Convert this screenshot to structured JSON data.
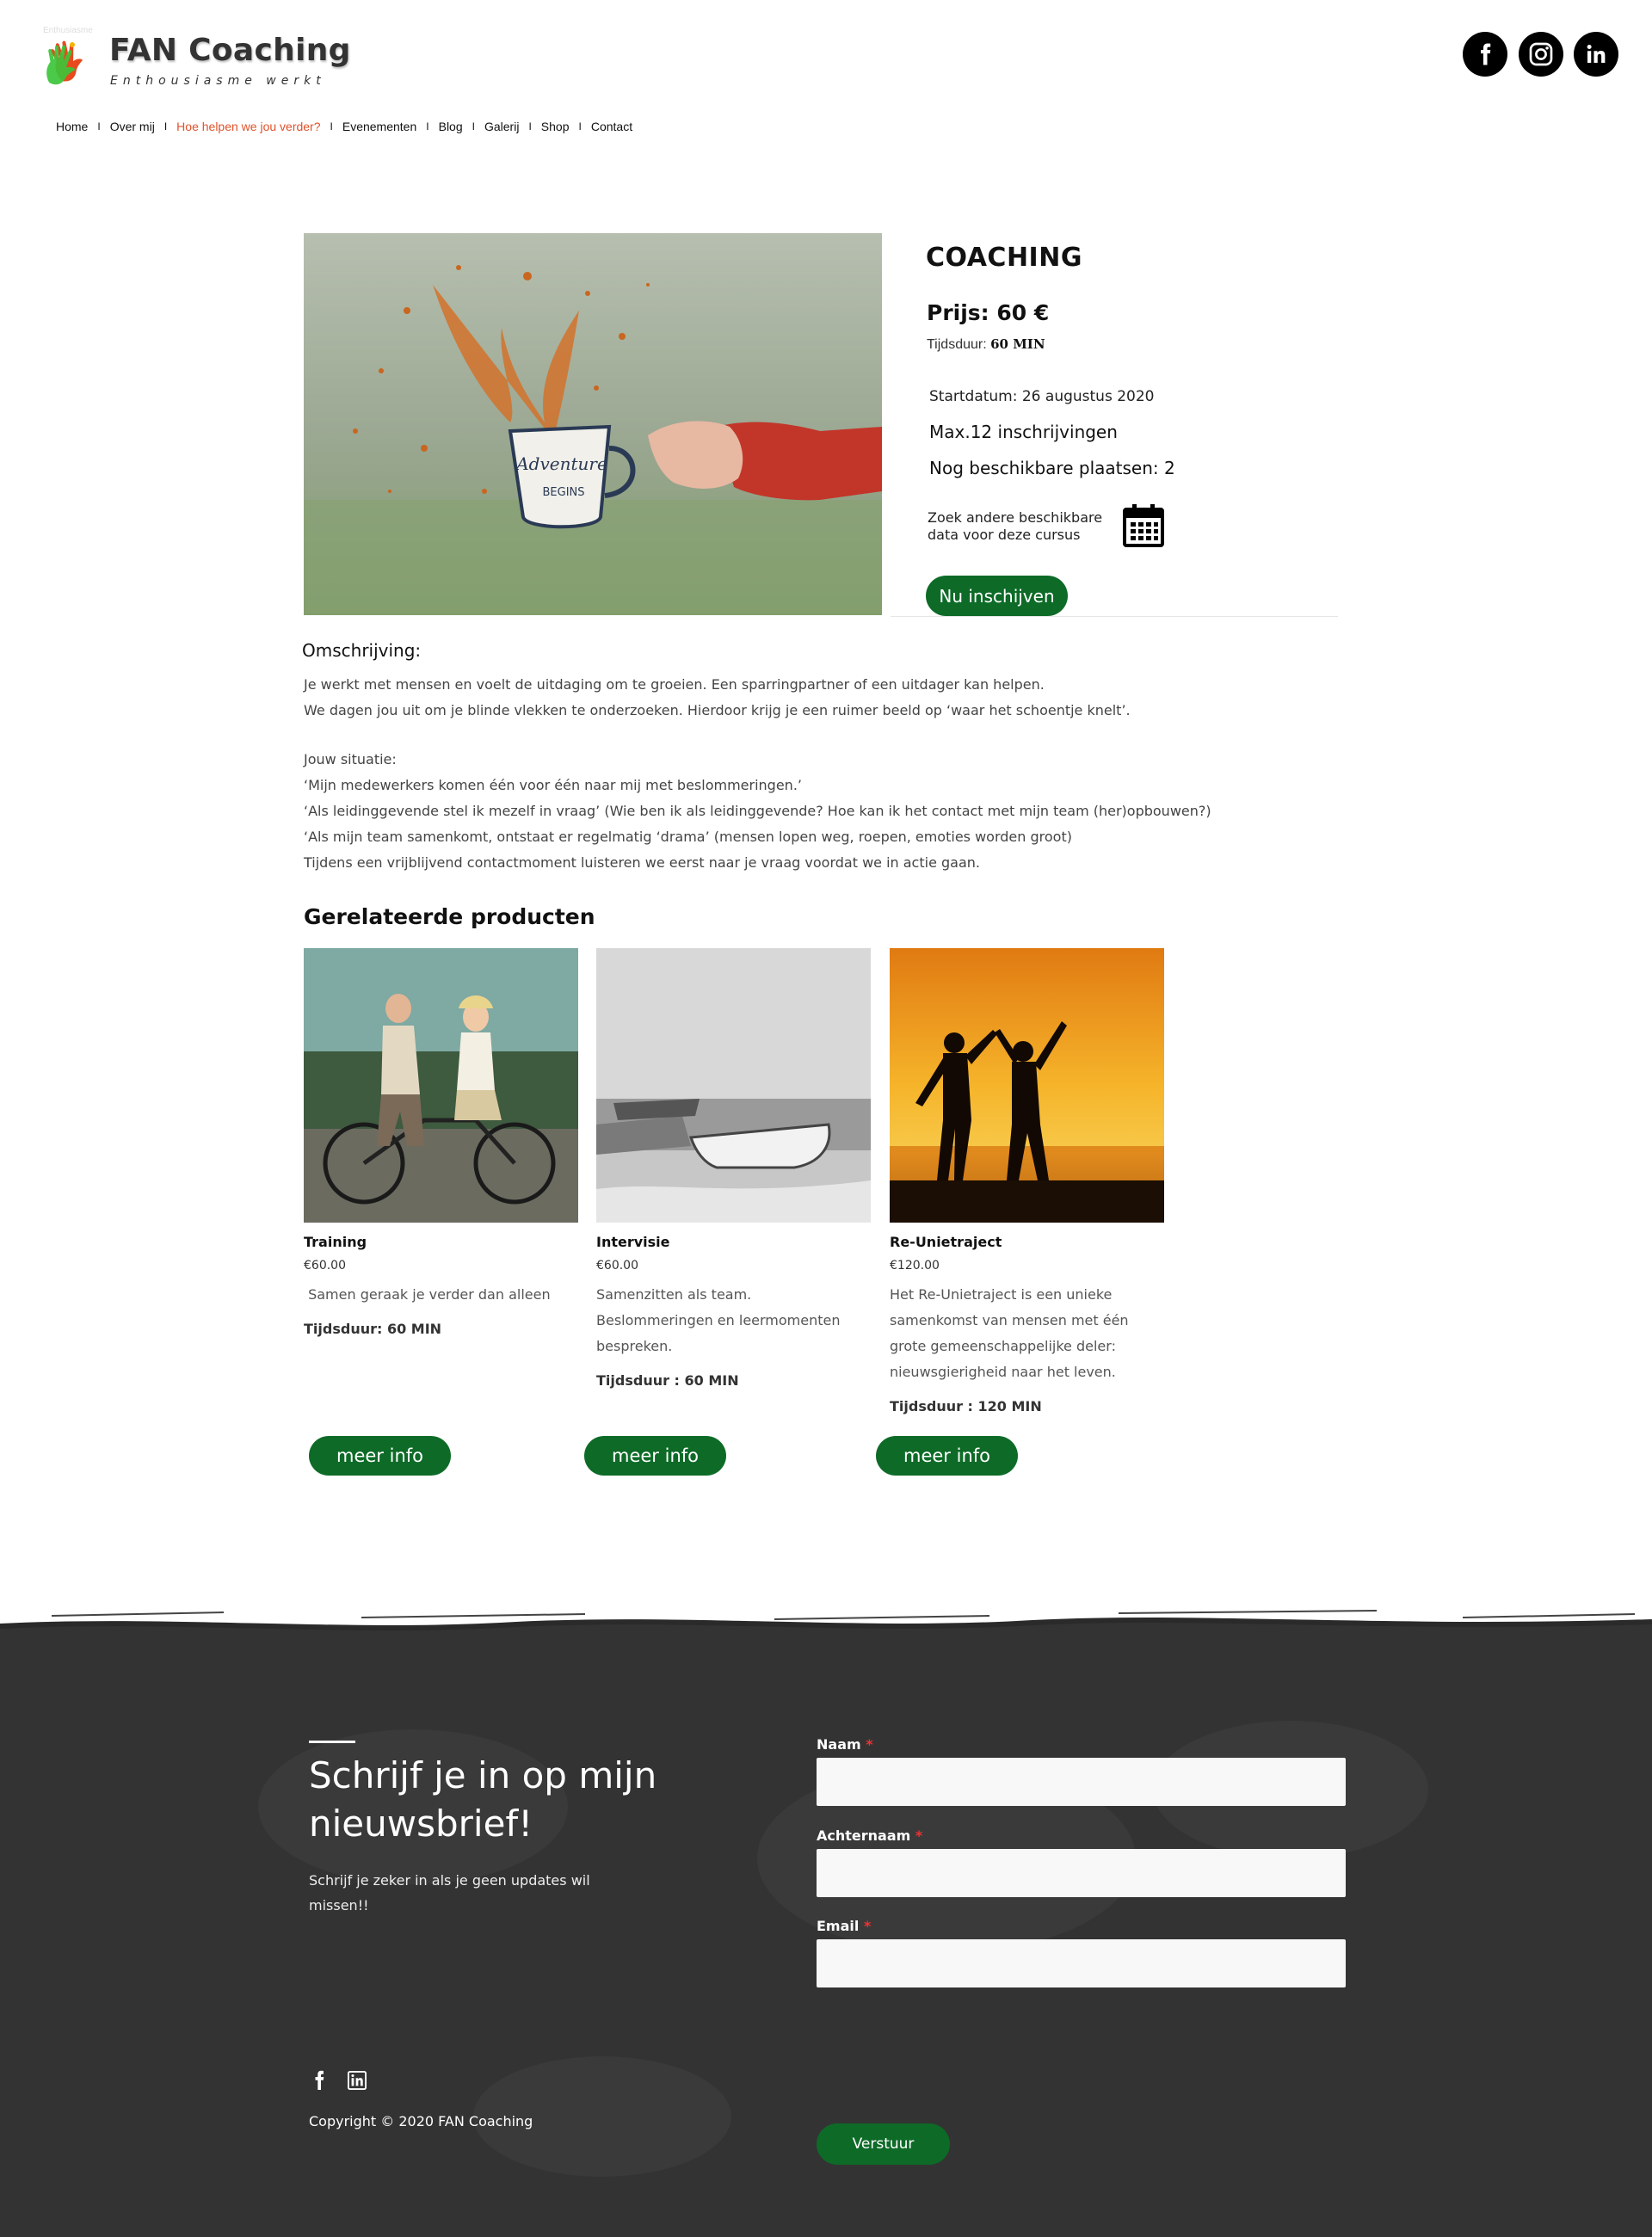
{
  "header": {
    "tiny_text": "Enthusiasme",
    "brand_name": "FAN Coaching",
    "tagline": "Enthousiasme werkt",
    "social_icons": [
      "facebook-icon",
      "instagram-icon",
      "linkedin-icon"
    ]
  },
  "nav": {
    "items": [
      "Home",
      "Over mij",
      "Hoe helpen we jou verder?",
      "Evenementen",
      "Blog",
      "Galerij",
      "Shop",
      "Contact"
    ],
    "separator": "I",
    "active_index": 2,
    "active_color": "#e0522a"
  },
  "product": {
    "title": "COACHING",
    "price": "Prijs: 60 €",
    "duration_label": "Tijdsduur:",
    "duration_value": "60 MIN",
    "start_date": "Startdatum: 26 augustus 2020",
    "max_signups": "Max.12 inschrijvingen",
    "available": "Nog beschikbare plaatsen: 2",
    "search_other": "Zoek andere beschikbare data voor deze cursus",
    "enroll_button": "Nu inschijven",
    "image_icon": "coffee-splash-photo"
  },
  "description": {
    "heading": "Omschrijving:",
    "lines": [
      "Je werkt met mensen en voelt de uitdaging om te groeien. Een sparringpartner of een uitdager kan helpen.",
      "We dagen jou uit om je blinde vlekken te onderzoeken. Hierdoor krijg je een ruimer beeld op ‘waar het schoentje knelt’.",
      "Jouw situatie:",
      "‘Mijn medewerkers komen één voor één naar mij met beslommeringen.’",
      "‘Als leidinggevende stel ik mezelf in vraag’ (Wie ben ik als leidinggevende? Hoe kan ik het contact met mijn team (her)opbouwen?)",
      "‘Als mijn team samenkomt, ontstaat er regelmatig ‘drama’ (mensen lopen weg, roepen, emoties worden groot)",
      "Tijdens een vrijblijvend contactmoment luisteren we eerst naar je vraag voordat we in actie gaan."
    ]
  },
  "related": {
    "heading": "Gerelateerde producten",
    "button_label": "meer info",
    "products": [
      {
        "name": "Training",
        "price": "€60.00",
        "text": " Samen geraak je verder dan alleen",
        "duration": "Tijdsduur: 60 MIN",
        "image": "tandem-bicycle-photo"
      },
      {
        "name": "Intervisie",
        "price": "€60.00",
        "text": "Samenzitten als team. Beslommeringen en leermomenten bespreken.",
        "duration": "Tijdsduur : 60 MIN",
        "image": "boats-beach-photo"
      },
      {
        "name": "Re-Unietraject",
        "price": "€120.00",
        "text": "Het Re-Unietraject is een unieke samenkomst van mensen met één grote gemeenschappelijke deler: nieuwsgierigheid naar het leven.",
        "duration": "Tijdsduur : 120 MIN",
        "image": "sunset-silhouettes-photo"
      }
    ]
  },
  "footer": {
    "title": "Schrijf je in op mijn nieuwsbrief!",
    "subtitle": "Schrijf je zeker in als je geen updates wil missen!!",
    "fields": [
      {
        "label": "Naam",
        "required_mark": "*",
        "value": ""
      },
      {
        "label": "Achternaam",
        "required_mark": "*",
        "value": ""
      },
      {
        "label": "Email",
        "required_mark": "*",
        "value": ""
      }
    ],
    "submit_button": "Verstuur",
    "copyright": "Copyright © 2020 FAN Coaching",
    "social_icons": [
      "facebook-icon",
      "linkedin-icon"
    ],
    "background_color": "#333333",
    "button_color": "#0d6b27"
  }
}
